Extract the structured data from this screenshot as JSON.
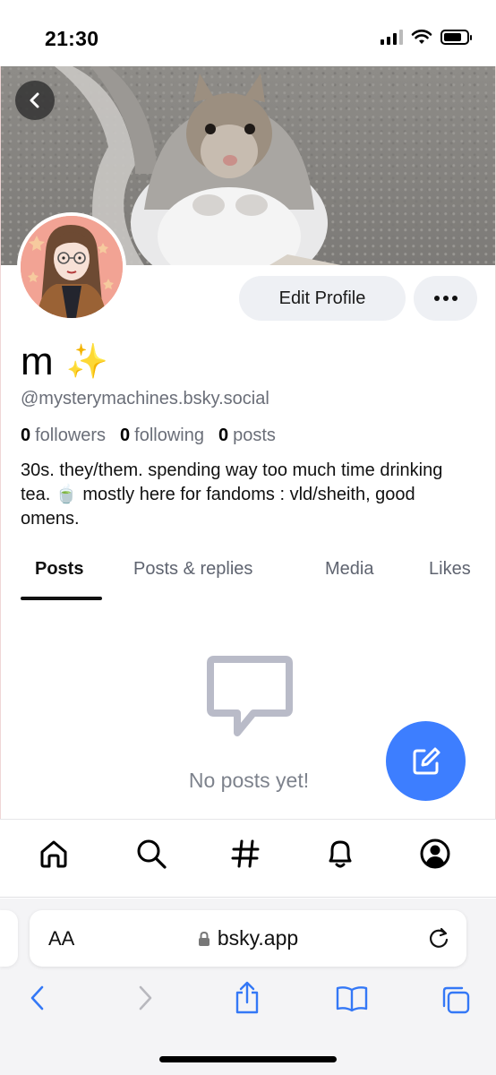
{
  "status_bar": {
    "time": "21:30"
  },
  "profile": {
    "display_name": "m",
    "handle": "@mysterymachines.bsky.social",
    "stats": {
      "followers_count": "0",
      "followers_label": "followers",
      "following_count": "0",
      "following_label": "following",
      "posts_count": "0",
      "posts_label": "posts"
    },
    "bio": "30s. they/them. spending way too much time drinking tea. 🍵 mostly here for fandoms : vld/sheith, good omens.",
    "edit_label": "Edit Profile"
  },
  "tabs": [
    {
      "label": "Posts",
      "active": true
    },
    {
      "label": "Posts & replies",
      "active": false
    },
    {
      "label": "Media",
      "active": false
    },
    {
      "label": "Likes",
      "active": false
    }
  ],
  "empty_state": {
    "text": "No posts yet!"
  },
  "bottom_nav": [
    "home-icon",
    "search-icon",
    "hashtag-icon",
    "notifications-icon",
    "profile-icon"
  ],
  "browser": {
    "aa_label": "AA",
    "url": "bsky.app"
  },
  "colors": {
    "accent": "#3d7eff",
    "muted_text": "#6a6e78",
    "browser_blue": "#3478f6"
  }
}
